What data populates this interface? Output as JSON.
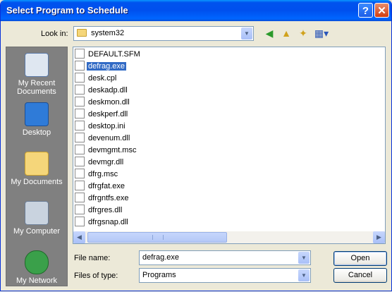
{
  "window": {
    "title": "Select Program to Schedule",
    "help_glyph": "?",
    "close_glyph": "✕"
  },
  "lookin": {
    "label": "Look in:",
    "value": "system32"
  },
  "toolbar": {
    "back_icon": "back-icon",
    "up_icon": "up-folder-icon",
    "newfolder_icon": "new-folder-icon",
    "views_icon": "views-menu-icon"
  },
  "places": [
    {
      "label": "My Recent Documents",
      "icon": "recent-documents-icon"
    },
    {
      "label": "Desktop",
      "icon": "desktop-icon"
    },
    {
      "label": "My Documents",
      "icon": "my-documents-icon"
    },
    {
      "label": "My Computer",
      "icon": "my-computer-icon"
    },
    {
      "label": "My Network",
      "icon": "my-network-icon"
    }
  ],
  "files": [
    {
      "name": "DEFAULT.SFM",
      "selected": false
    },
    {
      "name": "defrag.exe",
      "selected": true
    },
    {
      "name": "desk.cpl",
      "selected": false
    },
    {
      "name": "deskadp.dll",
      "selected": false
    },
    {
      "name": "deskmon.dll",
      "selected": false
    },
    {
      "name": "deskperf.dll",
      "selected": false
    },
    {
      "name": "desktop.ini",
      "selected": false
    },
    {
      "name": "devenum.dll",
      "selected": false
    },
    {
      "name": "devmgmt.msc",
      "selected": false
    },
    {
      "name": "devmgr.dll",
      "selected": false
    },
    {
      "name": "dfrg.msc",
      "selected": false
    },
    {
      "name": "dfrgfat.exe",
      "selected": false
    },
    {
      "name": "dfrgntfs.exe",
      "selected": false
    },
    {
      "name": "dfrgres.dll",
      "selected": false
    },
    {
      "name": "dfrgsnap.dll",
      "selected": false
    }
  ],
  "filename": {
    "label": "File name:",
    "value": "defrag.exe"
  },
  "filetype": {
    "label": "Files of type:",
    "value": "Programs"
  },
  "buttons": {
    "open": "Open",
    "cancel": "Cancel"
  },
  "colors": {
    "titlebar": "#0053ee",
    "selection": "#316ac5",
    "places_bg": "#808080",
    "dialog_bg": "#ece9d8"
  }
}
